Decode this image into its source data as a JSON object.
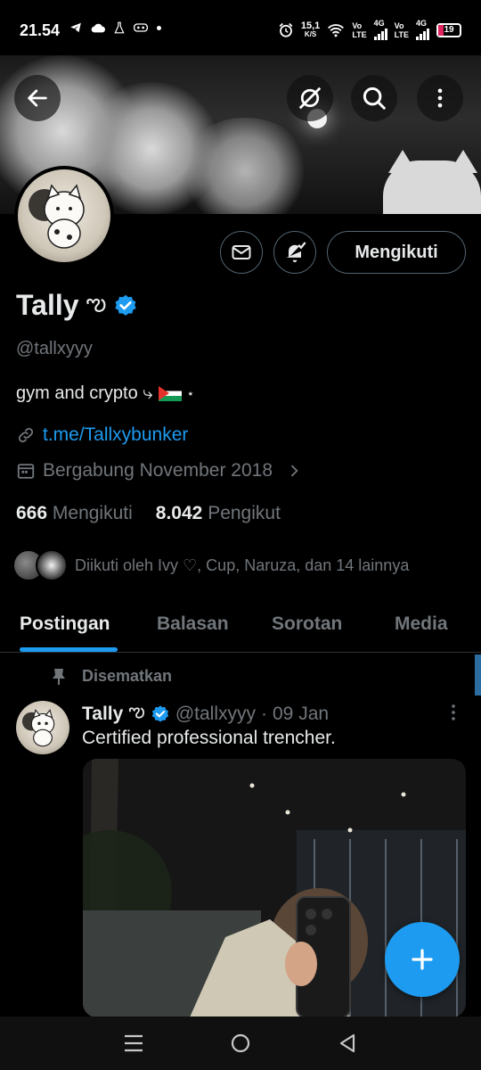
{
  "status_bar": {
    "time": "21.54",
    "net_speed_value": "15,1",
    "net_speed_unit": "K/S",
    "sim1_label_top": "Vo",
    "sim1_label_bottom": "LTE",
    "sim1_gen": "4G",
    "sim2_label_top": "Vo",
    "sim2_label_bottom": "LTE",
    "sim2_gen": "4G",
    "battery_level": "19"
  },
  "profile": {
    "name": "Tally",
    "name_emoji": "ఌ",
    "handle": "@tallxyyy",
    "bio": "gym and crypto ⤷",
    "bio_tail": "⋆",
    "link": "t.me/Tallxybunker",
    "joined": "Bergabung November 2018",
    "following_count": "666",
    "following_label": "Mengikuti",
    "followers_count": "8.042",
    "followers_label": "Pengikut",
    "followed_by": "Diikuti oleh Ivy ♡, Cup, Naruza, dan 14 lainnya",
    "follow_button_label": "Mengikuti"
  },
  "tabs": [
    {
      "label": "Postingan"
    },
    {
      "label": "Balasan"
    },
    {
      "label": "Sorotan"
    },
    {
      "label": "Media"
    }
  ],
  "post": {
    "pinned_label": "Disematkan",
    "author_name": "Tally",
    "author_emoji": "ఌ",
    "author_handle": "@tallxyyy",
    "separator": "·",
    "date": "09 Jan",
    "text": "Certified professional trencher."
  },
  "colors": {
    "accent": "#1d9bf0",
    "background": "#000000",
    "muted_text": "#71767b"
  },
  "icons": {
    "back": "arrow-left-icon",
    "grok": "grok-icon",
    "search": "search-icon",
    "more": "more-vertical-icon",
    "message": "mail-icon",
    "notify": "bell-check-icon",
    "verified": "verified-badge-icon",
    "link": "link-icon",
    "calendar": "calendar-icon",
    "pin": "pin-icon",
    "compose": "plus-icon"
  }
}
